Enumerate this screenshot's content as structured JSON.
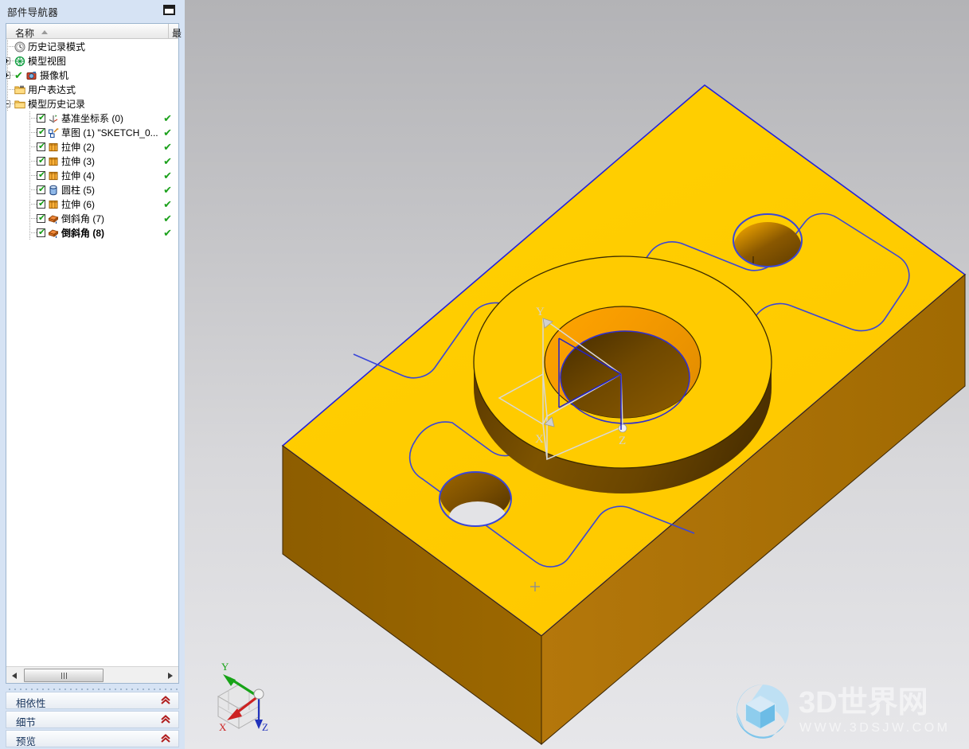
{
  "panel": {
    "title": "部件导航器",
    "dock_button": "dock-icon",
    "columns": [
      "名称",
      "最"
    ],
    "sort_indicator": "ascending"
  },
  "tree": [
    {
      "label": "历史记录模式",
      "icon": "clock-icon",
      "indent": 0,
      "expander": "none",
      "checkbox": false,
      "status": false,
      "bold": false
    },
    {
      "label": "模型视图",
      "icon": "model-view-icon",
      "indent": 0,
      "expander": "plus",
      "checkbox": false,
      "status": false,
      "bold": false
    },
    {
      "label": "摄像机",
      "icon": "camera-icon",
      "indent": 0,
      "expander": "plus",
      "checkbox": false,
      "status": false,
      "bold": false,
      "greencheck": true
    },
    {
      "label": "用户表达式",
      "icon": "folder-expr-icon",
      "indent": 0,
      "expander": "none",
      "checkbox": false,
      "status": false,
      "bold": false
    },
    {
      "label": "模型历史记录",
      "icon": "folder-icon",
      "indent": 0,
      "expander": "minus",
      "checkbox": false,
      "status": false,
      "bold": false
    },
    {
      "label": "基准坐标系 (0)",
      "icon": "datum-csys-icon",
      "indent": 1,
      "expander": "none",
      "checkbox": true,
      "status": true,
      "bold": false
    },
    {
      "label": "草图 (1) \"SKETCH_0...",
      "icon": "sketch-icon",
      "indent": 1,
      "expander": "none",
      "checkbox": true,
      "status": true,
      "bold": false
    },
    {
      "label": "拉伸 (2)",
      "icon": "extrude-icon",
      "indent": 1,
      "expander": "none",
      "checkbox": true,
      "status": true,
      "bold": false
    },
    {
      "label": "拉伸 (3)",
      "icon": "extrude-icon",
      "indent": 1,
      "expander": "none",
      "checkbox": true,
      "status": true,
      "bold": false
    },
    {
      "label": "拉伸 (4)",
      "icon": "extrude-icon",
      "indent": 1,
      "expander": "none",
      "checkbox": true,
      "status": true,
      "bold": false
    },
    {
      "label": "圆柱 (5)",
      "icon": "cylinder-icon",
      "indent": 1,
      "expander": "none",
      "checkbox": true,
      "status": true,
      "bold": false
    },
    {
      "label": "拉伸 (6)",
      "icon": "extrude-icon",
      "indent": 1,
      "expander": "none",
      "checkbox": true,
      "status": true,
      "bold": false
    },
    {
      "label": "倒斜角 (7)",
      "icon": "chamfer-icon",
      "indent": 1,
      "expander": "none",
      "checkbox": true,
      "status": true,
      "bold": false
    },
    {
      "label": "倒斜角 (8)",
      "icon": "chamfer-icon",
      "indent": 1,
      "expander": "none",
      "checkbox": true,
      "status": true,
      "bold": true
    }
  ],
  "sections": [
    {
      "label": "相依性",
      "chevron": "collapse-up-icon"
    },
    {
      "label": "细节",
      "chevron": "collapse-up-icon"
    },
    {
      "label": "预览",
      "chevron": "collapse-up-icon"
    }
  ],
  "scrollbar": {
    "left_arrow": "arrow-left-icon",
    "right_arrow": "arrow-right-icon"
  },
  "triad": {
    "x": "X",
    "y": "Y",
    "z": "Z"
  },
  "watermark": {
    "title": "3D世界网",
    "url": "WWW.3DSJW.COM"
  },
  "colors": {
    "top_face": "#FFCC00",
    "side_face_light": "#b3790b",
    "side_face_dark": "#8a5c00",
    "hole_dark": "#6b4400",
    "edge_blue": "#2222dd",
    "bg_top": "#b3b3b6",
    "bg_bottom": "#e7e7ea",
    "panel_bg": "#d6e3f4",
    "section_text": "#16335c",
    "chevron_red": "#b01c1c",
    "check_green": "#1aa01a",
    "axis_x": "#cc2222",
    "axis_y": "#17a317",
    "axis_z": "#2233bb"
  }
}
